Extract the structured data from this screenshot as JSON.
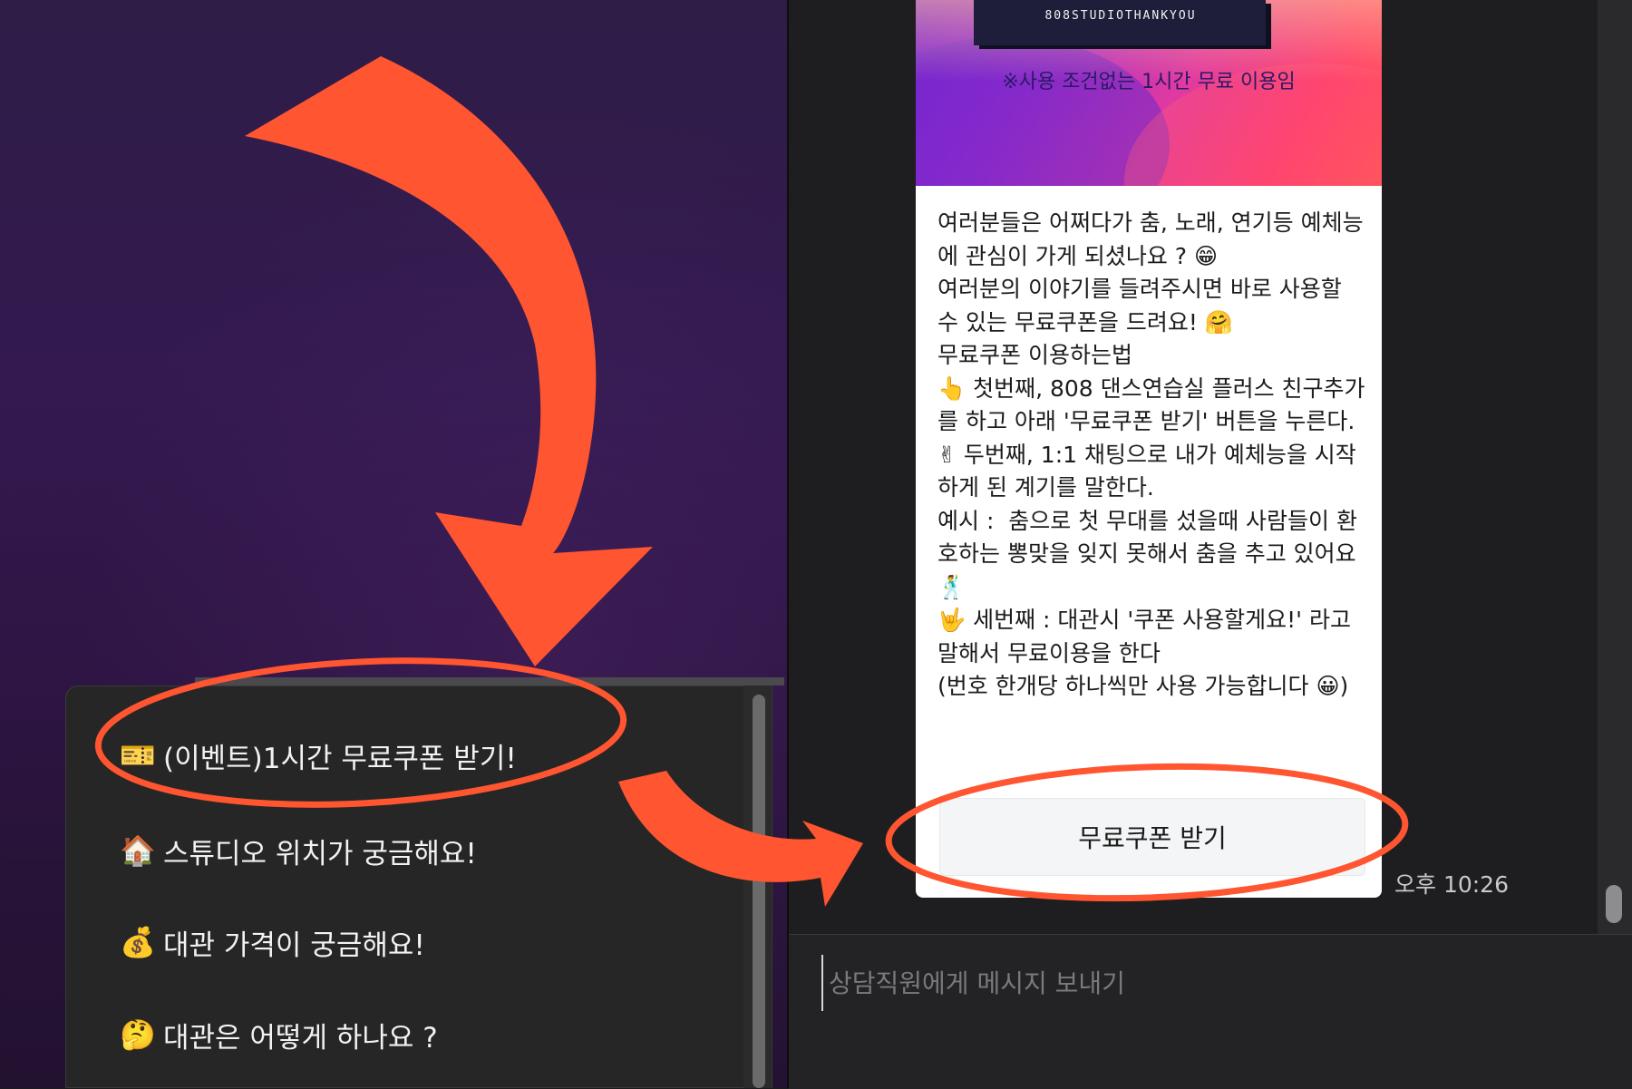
{
  "quick_replies": {
    "items": [
      {
        "icon": "ticket-icon",
        "emoji": "🎫",
        "label": "(이벤트)1시간 무료쿠폰 받기!"
      },
      {
        "icon": "house-icon",
        "emoji": "🏠",
        "label": "스튜디오 위치가 궁금해요!"
      },
      {
        "icon": "money-bag-icon",
        "emoji": "💰",
        "label": "대관 가격이 궁금해요!"
      },
      {
        "icon": "thinking-face-icon",
        "emoji": "🤔",
        "label": "대관은 어떻게 하나요 ?"
      }
    ]
  },
  "message": {
    "ticket_code": "808STUDIOTHANKYOU",
    "banner_note": "※사용 조건없는 1시간 무료 이용임",
    "body": "여러분들은 어쩌다가 춤, 노래, 연기등 예체능에 관심이 가게 되셨나요 ? 😁\n여러분의 이야기를 들려주시면 바로 사용할 수 있는 무료쿠폰을 드려요! 🤗\n무료쿠폰 이용하는법\n👆 첫번째, 808 댄스연습실 플러스 친구추가를 하고 아래 '무료쿠폰 받기' 버튼을 누른다.\n✌ 두번째, 1:1 채팅으로 내가 예체능을 시작하게 된 계기를 말한다.\n예시 :  춤으로 첫 무대를 섰을때 사람들이 환호하는 뽕맞을 잊지 못해서 춤을 추고 있어요 🕺\n🤟 세번째 : 대관시 '쿠폰 사용할게요!' 라고 말해서 무료이용을 한다\n(번호 한개당 하나씩만 사용 가능합니다 😀)",
    "button_label": "무료쿠폰 받기",
    "timestamp": "오후 10:26"
  },
  "composer": {
    "placeholder": "상담직원에게 메시지 보내기"
  },
  "colors": {
    "annotation": "#ff5530",
    "card": "#ffffff",
    "panel": "#1e1e20"
  }
}
